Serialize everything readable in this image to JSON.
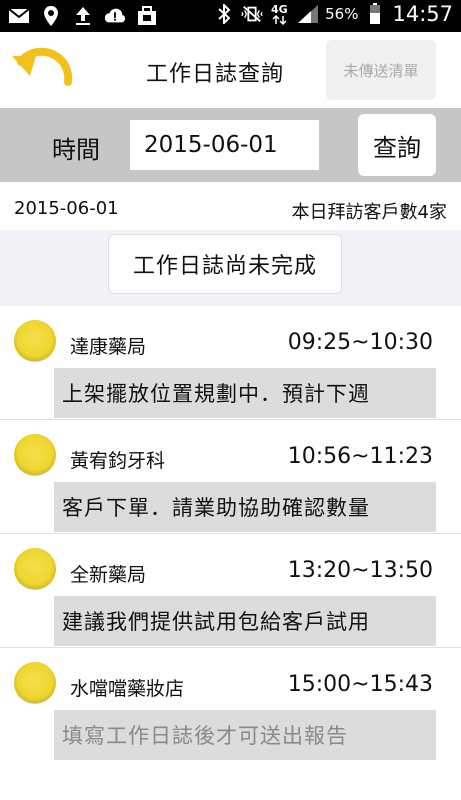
{
  "status_bar": {
    "icons_left": [
      "mail-icon",
      "location-icon",
      "upload-icon",
      "cloud-alert-icon",
      "briefcase-icon"
    ],
    "icons_right": [
      "bluetooth-icon",
      "vibrate-icon",
      "network-4g-icon",
      "signal-icon"
    ],
    "battery": "56%",
    "time": "14:57"
  },
  "header": {
    "title": "工作日誌查詢",
    "unsent_label": "未傳送清單"
  },
  "search": {
    "time_label": "時間",
    "date_value": "2015-06-01",
    "query_label": "查詢"
  },
  "info": {
    "date": "2015-06-01",
    "visit_count_text": "本日拜訪客戶數4家"
  },
  "notice": {
    "label": "工作日誌尚未完成"
  },
  "colors": {
    "dot_yellow": "#efd630",
    "back_arrow": "#f2c21b",
    "bar_gray": "#c6c6c6",
    "note_gray": "#dcdcdc"
  },
  "visits": [
    {
      "shop": "達康藥局",
      "hours": "09:25~10:30",
      "note": "上架擺放位置規劃中．預計下週",
      "is_placeholder": false
    },
    {
      "shop": "黃宥鈞牙科",
      "hours": "10:56~11:23",
      "note": "客戶下單．請業助協助確認數量",
      "is_placeholder": false
    },
    {
      "shop": "全新藥局",
      "hours": "13:20~13:50",
      "note": "建議我們提供試用包給客戶試用",
      "is_placeholder": false
    },
    {
      "shop": "水噹噹藥妝店",
      "hours": "15:00~15:43",
      "note": "填寫工作日誌後才可送出報告",
      "is_placeholder": true
    }
  ]
}
